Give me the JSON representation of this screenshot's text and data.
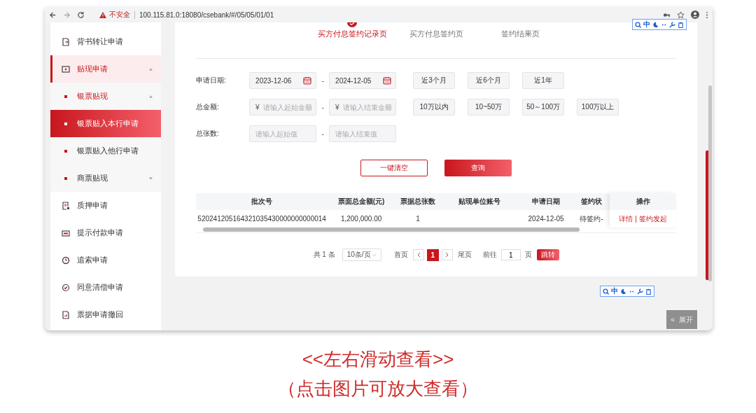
{
  "browser": {
    "security_label": "不安全",
    "url": "100.115.81.0:18080/csebank/#/05/05/01/01"
  },
  "ime_toolbars": [
    {
      "label": "中"
    },
    {
      "label": "中"
    }
  ],
  "sidebar": {
    "items": [
      {
        "label": "背书转让申请"
      },
      {
        "label": "贴现申请",
        "expanded": true,
        "children": [
          {
            "label": "银票贴现",
            "expanded": true,
            "children": [
              {
                "label": "银票贴入本行申请",
                "selected": true
              },
              {
                "label": "银票贴入他行申请",
                "selected": false
              }
            ]
          },
          {
            "label": "商票贴现",
            "expanded": false
          }
        ]
      },
      {
        "label": "质押申请"
      },
      {
        "label": "提示付款申请"
      },
      {
        "label": "追索申请"
      },
      {
        "label": "同意清偿申请"
      },
      {
        "label": "票据申请撤回"
      }
    ]
  },
  "steps": [
    {
      "label": "买方付息签约记录页",
      "selected": true
    },
    {
      "label": "买方付息签约页",
      "selected": false
    },
    {
      "label": "签约结果页",
      "selected": false
    }
  ],
  "filters": [
    {
      "label": "申请日期:",
      "kind": "date",
      "separator": "-",
      "fields": [
        {
          "value": "2023-12-06"
        },
        {
          "value": "2024-12-05"
        }
      ],
      "presets": [
        "近3个月",
        "近6个月",
        "近1年"
      ]
    },
    {
      "label": "总金额:",
      "kind": "amount",
      "separator": "-",
      "fields": [
        {
          "prefix": "¥",
          "placeholder": "请输入起始金额"
        },
        {
          "prefix": "¥",
          "placeholder": "请输入结束金额"
        }
      ],
      "presets": [
        "10万以内",
        "10~50万",
        "50～100万",
        "100万以上"
      ]
    },
    {
      "label": "总张数:",
      "kind": "count",
      "separator": "-",
      "fields": [
        {
          "placeholder": "请输入起始值"
        },
        {
          "placeholder": "请输入结束值"
        }
      ]
    }
  ],
  "actions": [
    {
      "label": "一键清空",
      "kind": "secondary"
    },
    {
      "label": "查询",
      "kind": "primary"
    }
  ],
  "table": {
    "columns": [
      "批次号",
      "票面总金额(元)",
      "票据总张数",
      "贴现单位账号",
      "申请日期",
      "签约状"
    ],
    "rows": [
      {
        "cells": [
          "520241205164321035430000000000014",
          "1,200,000.00",
          "1",
          null,
          "2024-12-05",
          "待签约-"
        ],
        "actions": [
          "详情",
          "签约发起"
        ]
      }
    ],
    "action_column": {
      "title": "操作",
      "separator": "|"
    }
  },
  "pagination": {
    "total": "共 1 条",
    "page_size": "10条/页",
    "first": "首页",
    "pages": [
      {
        "label": "1",
        "selected": true
      }
    ],
    "last": "尾页",
    "goto_label": "前往",
    "goto_value": "1",
    "goto_unit": "页",
    "goto_button": "跳转"
  },
  "expand_button": {
    "icon": "«",
    "label": "展开"
  },
  "caption": [
    "<<左右滑动查看>>",
    "（点击图片可放大查看）"
  ]
}
